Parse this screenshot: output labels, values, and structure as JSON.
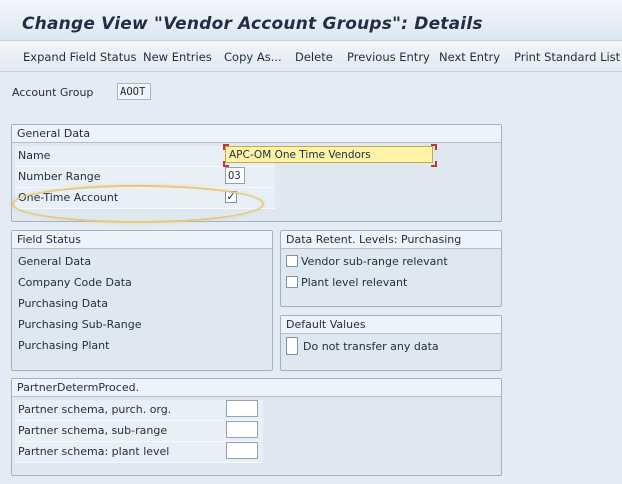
{
  "window": {
    "title": "Change View \"Vendor Account Groups\": Details"
  },
  "toolbar": {
    "expand_field_status": "Expand Field Status",
    "new_entries": "New Entries",
    "copy_as": "Copy As...",
    "delete": "Delete",
    "previous_entry": "Previous Entry",
    "next_entry": "Next Entry",
    "print_standard_list": "Print Standard List"
  },
  "header": {
    "account_group_label": "Account Group",
    "account_group_value": "AOOT"
  },
  "general_data": {
    "title": "General Data",
    "name_label": "Name",
    "name_value": "APC-OM One Time Vendors",
    "number_range_label": "Number Range",
    "number_range_value": "O3",
    "one_time_label": "One-Time Account",
    "one_time_checked": true,
    "check_mark": "✓"
  },
  "field_status": {
    "title": "Field Status",
    "items": [
      "General Data",
      "Company Code Data",
      "Purchasing Data",
      "Purchasing Sub-Range",
      "Purchasing Plant"
    ]
  },
  "data_retent": {
    "title": "Data Retent. Levels: Purchasing",
    "vendor_subrange_label": "Vendor sub-range relevant",
    "plant_level_label": "Plant level relevant"
  },
  "default_values": {
    "title": "Default Values",
    "do_not_transfer_label": "Do not transfer any data"
  },
  "partner": {
    "title": "PartnerDetermProced.",
    "schema_purch_org_label": "Partner schema, purch. org.",
    "schema_subrange_label": "Partner schema, sub-range",
    "schema_plant_label": "Partner schema: plant level",
    "schema_purch_org_value": "",
    "schema_subrange_value": "",
    "schema_plant_value": ""
  },
  "colors": {
    "background": "#e4ebf4",
    "focus_field": "#fff3a8",
    "highlight_ring": "#e3c978",
    "error_marker": "#c0392b"
  }
}
